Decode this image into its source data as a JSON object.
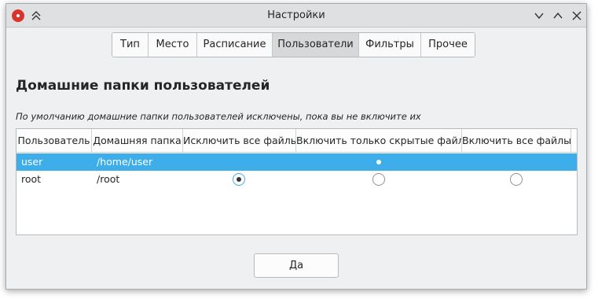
{
  "window": {
    "title": "Настройки",
    "icons": [
      "app-icon",
      "keep-above-icon",
      "minimize-icon",
      "maximize-icon",
      "close-icon"
    ]
  },
  "tabs": [
    {
      "label": "Тип",
      "active": false
    },
    {
      "label": "Место",
      "active": false
    },
    {
      "label": "Расписание",
      "active": false
    },
    {
      "label": "Пользователи",
      "active": true
    },
    {
      "label": "Фильтры",
      "active": false
    },
    {
      "label": "Прочее",
      "active": false
    }
  ],
  "section": {
    "title": "Домашние папки пользователей",
    "hint": "По умолчанию домашние папки пользователей исключены, пока вы не включите их"
  },
  "table": {
    "columns": [
      "Пользователь",
      "Домашняя папка",
      "Исключить все файлы",
      "Включить только скрытые файлы",
      "Включить все файлы"
    ],
    "rows": [
      {
        "user": "user",
        "home": "/home/user",
        "mode": "Включить только скрытые файлы",
        "selected": true
      },
      {
        "user": "root",
        "home": "/root",
        "mode": "Исключить все файлы",
        "selected": false
      }
    ]
  },
  "footer": {
    "ok_label": "Да"
  },
  "colors": {
    "selection": "#3daee9",
    "window_bg": "#eff0f1",
    "titlebar_bg": "#dee0e2"
  }
}
